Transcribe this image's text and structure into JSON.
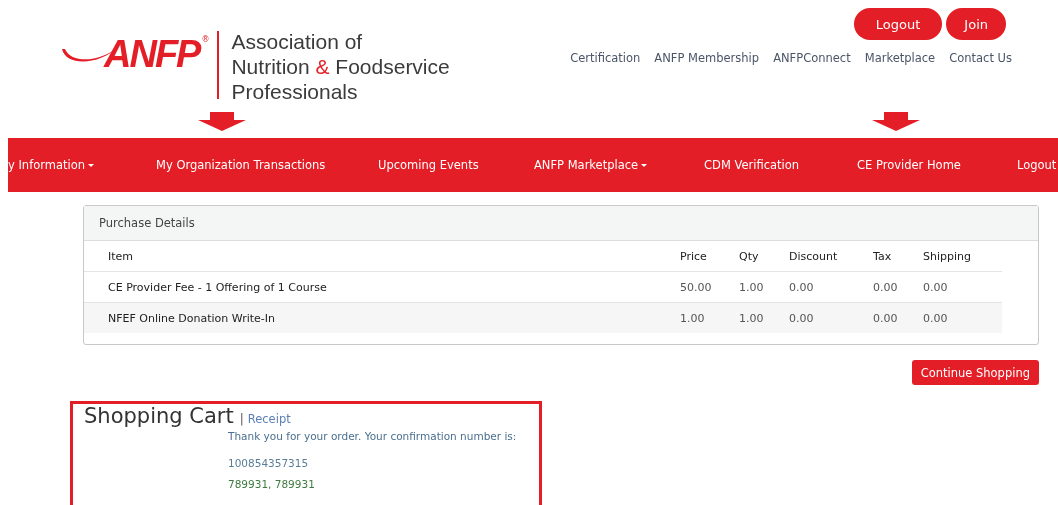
{
  "logo": {
    "mark": "ANFP",
    "registered": "®",
    "tagline": [
      [
        {
          "text": "Association of",
          "accent": false
        }
      ],
      [
        {
          "text": "Nutrition ",
          "accent": false
        },
        {
          "text": "&",
          "accent": true
        },
        {
          "text": " Foodservice",
          "accent": false
        }
      ],
      [
        {
          "text": "Professionals",
          "accent": false
        }
      ]
    ]
  },
  "account_buttons": [
    "Logout",
    "Join"
  ],
  "top_links": [
    "Certification",
    "ANFP Membership",
    "ANFPConnect",
    "Marketplace",
    "Contact Us"
  ],
  "nav": [
    {
      "label": "y Information",
      "dropdown": true
    },
    {
      "label": "My Organization Transactions",
      "dropdown": false
    },
    {
      "label": "Upcoming Events",
      "dropdown": false
    },
    {
      "label": "ANFP Marketplace",
      "dropdown": true
    },
    {
      "label": "CDM Verification",
      "dropdown": false
    },
    {
      "label": "CE Provider Home",
      "dropdown": false
    },
    {
      "label": "Logout",
      "dropdown": false
    }
  ],
  "purchase_details": {
    "title": "Purchase Details",
    "columns": [
      "Item",
      "Price",
      "Qty",
      "Discount",
      "Tax",
      "Shipping"
    ],
    "rows": [
      [
        "CE Provider Fee - 1 Offering of 1 Course",
        "50.00",
        "1.00",
        "0.00",
        "0.00",
        "0.00"
      ],
      [
        "NFEF Online Donation Write-In",
        "1.00",
        "1.00",
        "0.00",
        "0.00",
        "0.00"
      ]
    ]
  },
  "continue_button": "Continue Shopping",
  "shopping_cart": {
    "title": "Shopping Cart",
    "separator": "|",
    "receipt_link": "Receipt",
    "message": "Thank you for your order. Your confirmation number is:",
    "confirmation_number": "100854357315",
    "codes": "789931, 789931"
  }
}
